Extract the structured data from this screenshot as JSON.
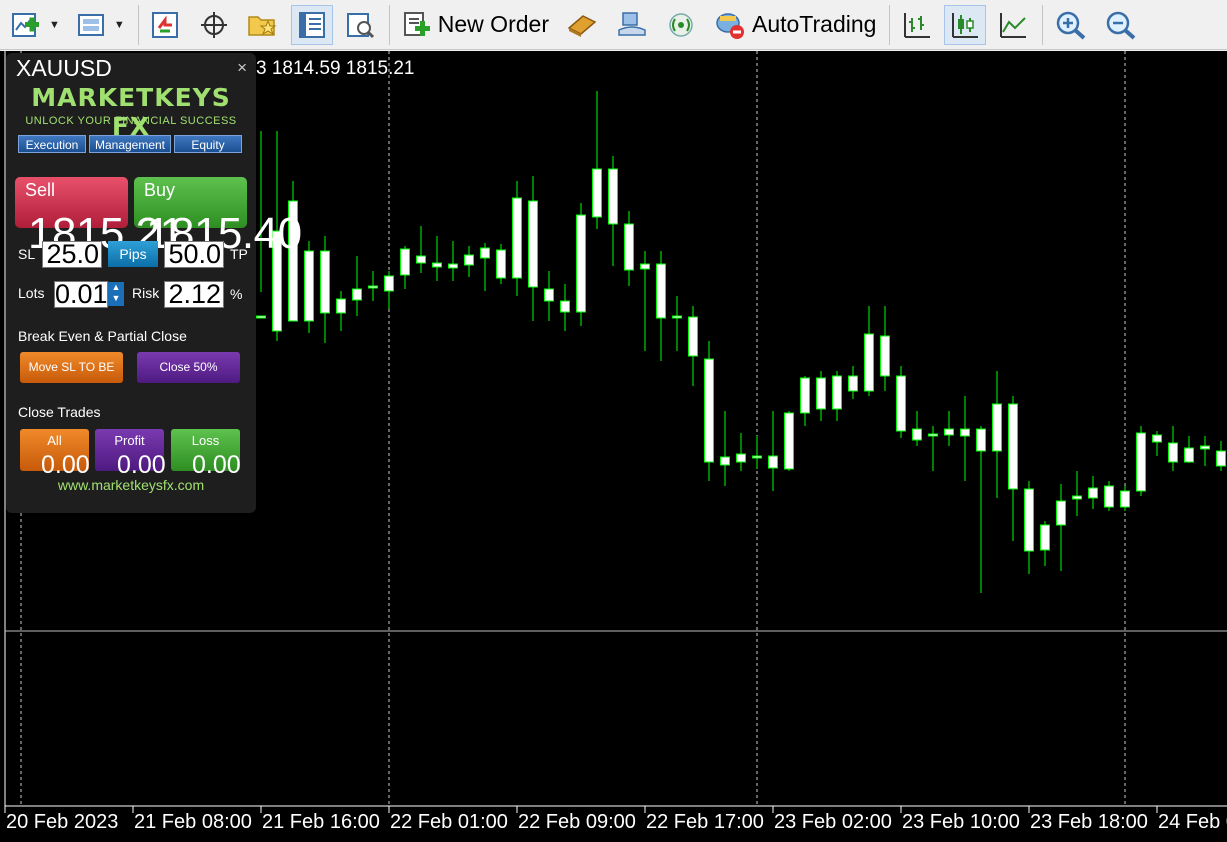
{
  "toolbar": {
    "new_order_label": "New Order",
    "autotrading_label": "AutoTrading"
  },
  "chart": {
    "price_header": "3 1814.59 1815.21",
    "time_labels": [
      "20 Feb 2023",
      "21 Feb 08:00",
      "21 Feb 16:00",
      "22 Feb 01:00",
      "22 Feb 09:00",
      "22 Feb 17:00",
      "23 Feb 02:00",
      "23 Feb 10:00",
      "23 Feb 18:00",
      "24 Feb 0"
    ],
    "colors": {
      "background": "#000000",
      "candle": "#00ff00",
      "bull_body": "#000000",
      "bear_body": "#ffffff",
      "axis": "#ffffff"
    }
  },
  "panel": {
    "symbol": "XAUUSD",
    "close": "×",
    "logo": "MARKETKEYS FX",
    "tagline": "UNLOCK YOUR FINANCIAL SUCCESS",
    "tabs": [
      "Execution",
      "Management",
      "Equity"
    ],
    "sell_label": "Sell",
    "buy_label": "Buy",
    "sell_price": "1815.21",
    "buy_price": "1815.40",
    "sl_label": "SL",
    "sl_value": "25.0",
    "pips_label": "Pips",
    "tp_value": "50.0",
    "tp_label": "TP",
    "lots_label": "Lots",
    "lots_value": "0.01",
    "risk_label": "Risk",
    "risk_value": "2.12",
    "percent": "%",
    "be_title": "Break Even & Partial Close",
    "move_sl_label": "Move SL TO BE",
    "close50_label": "Close 50%",
    "close_trades_title": "Close Trades",
    "all_label": "All",
    "profit_label": "Profit",
    "loss_label": "Loss",
    "all_value": "0.00",
    "profit_value": "0.00",
    "loss_value": "0.00",
    "url": "www.marketkeysfx.com"
  }
}
